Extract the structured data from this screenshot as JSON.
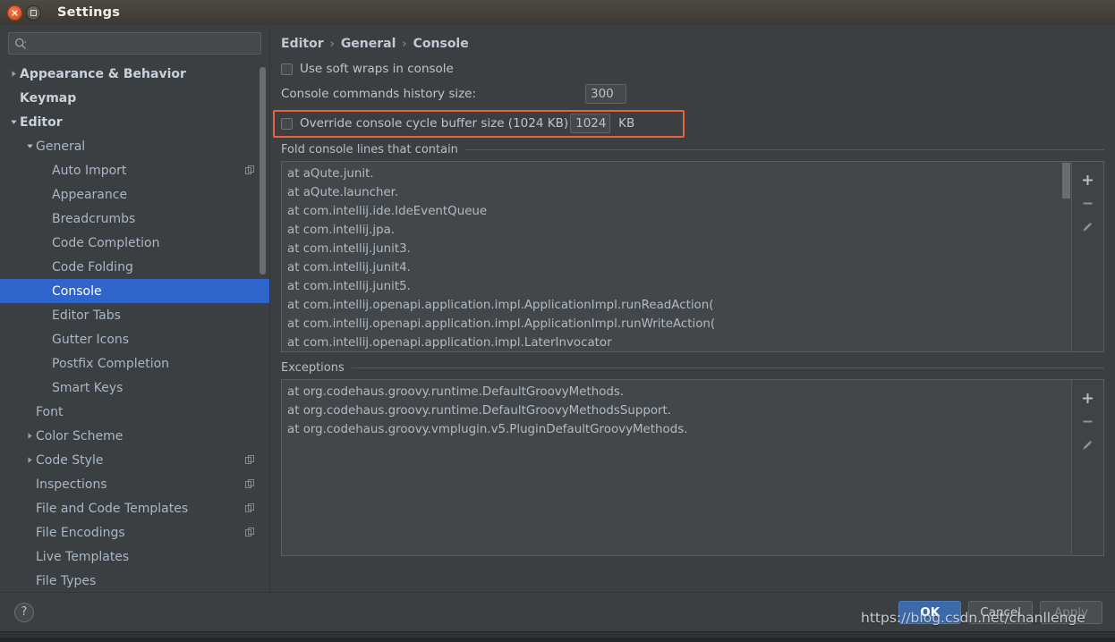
{
  "window": {
    "title": "Settings",
    "close_icon": "close-icon",
    "maximize_icon": "maximize-icon"
  },
  "sidebar": {
    "search": {
      "placeholder": "",
      "value": "",
      "icon": "search-icon"
    },
    "items": [
      {
        "label": "Appearance & Behavior",
        "indent": 0,
        "arrow": "right",
        "bold": true,
        "badge": false,
        "selected": false
      },
      {
        "label": "Keymap",
        "indent": 0,
        "arrow": "none",
        "bold": true,
        "badge": false,
        "selected": false
      },
      {
        "label": "Editor",
        "indent": 0,
        "arrow": "down",
        "bold": true,
        "badge": false,
        "selected": false
      },
      {
        "label": "General",
        "indent": 1,
        "arrow": "down",
        "bold": false,
        "badge": false,
        "selected": false
      },
      {
        "label": "Auto Import",
        "indent": 2,
        "arrow": "none",
        "bold": false,
        "badge": true,
        "selected": false
      },
      {
        "label": "Appearance",
        "indent": 2,
        "arrow": "none",
        "bold": false,
        "badge": false,
        "selected": false
      },
      {
        "label": "Breadcrumbs",
        "indent": 2,
        "arrow": "none",
        "bold": false,
        "badge": false,
        "selected": false
      },
      {
        "label": "Code Completion",
        "indent": 2,
        "arrow": "none",
        "bold": false,
        "badge": false,
        "selected": false
      },
      {
        "label": "Code Folding",
        "indent": 2,
        "arrow": "none",
        "bold": false,
        "badge": false,
        "selected": false
      },
      {
        "label": "Console",
        "indent": 2,
        "arrow": "none",
        "bold": false,
        "badge": false,
        "selected": true
      },
      {
        "label": "Editor Tabs",
        "indent": 2,
        "arrow": "none",
        "bold": false,
        "badge": false,
        "selected": false
      },
      {
        "label": "Gutter Icons",
        "indent": 2,
        "arrow": "none",
        "bold": false,
        "badge": false,
        "selected": false
      },
      {
        "label": "Postfix Completion",
        "indent": 2,
        "arrow": "none",
        "bold": false,
        "badge": false,
        "selected": false
      },
      {
        "label": "Smart Keys",
        "indent": 2,
        "arrow": "none",
        "bold": false,
        "badge": false,
        "selected": false
      },
      {
        "label": "Font",
        "indent": 1,
        "arrow": "none",
        "bold": false,
        "badge": false,
        "selected": false
      },
      {
        "label": "Color Scheme",
        "indent": 1,
        "arrow": "right",
        "bold": false,
        "badge": false,
        "selected": false
      },
      {
        "label": "Code Style",
        "indent": 1,
        "arrow": "right",
        "bold": false,
        "badge": true,
        "selected": false
      },
      {
        "label": "Inspections",
        "indent": 1,
        "arrow": "none",
        "bold": false,
        "badge": true,
        "selected": false
      },
      {
        "label": "File and Code Templates",
        "indent": 1,
        "arrow": "none",
        "bold": false,
        "badge": true,
        "selected": false
      },
      {
        "label": "File Encodings",
        "indent": 1,
        "arrow": "none",
        "bold": false,
        "badge": true,
        "selected": false
      },
      {
        "label": "Live Templates",
        "indent": 1,
        "arrow": "none",
        "bold": false,
        "badge": false,
        "selected": false
      },
      {
        "label": "File Types",
        "indent": 1,
        "arrow": "none",
        "bold": false,
        "badge": false,
        "selected": false
      }
    ]
  },
  "breadcrumb": {
    "part1": "Editor",
    "sep1": "›",
    "part2": "General",
    "sep2": "›",
    "part3": "Console"
  },
  "settings": {
    "soft_wraps_label": "Use soft wraps in console",
    "soft_wraps_checked": false,
    "history_label": "Console commands history size:",
    "history_value": "300",
    "override_label": "Override console cycle buffer size (1024 KB)",
    "override_checked": false,
    "override_value": "1024",
    "override_unit": "KB",
    "highlight_color": "#e8623a"
  },
  "fold_section": {
    "title": "Fold console lines that contain",
    "lines": [
      "at aQute.junit.",
      "at aQute.launcher.",
      "at com.intellij.ide.IdeEventQueue",
      "at com.intellij.jpa.",
      "at com.intellij.junit3.",
      "at com.intellij.junit4.",
      "at com.intellij.junit5.",
      "at com.intellij.openapi.application.impl.ApplicationImpl.runReadAction(",
      "at com.intellij.openapi.application.impl.ApplicationImpl.runWriteAction(",
      "at com.intellij.openapi.application.impl.LaterInvocator"
    ],
    "toolbar": {
      "add": "+",
      "remove": "−",
      "edit": "pencil-icon"
    }
  },
  "exceptions_section": {
    "title": "Exceptions",
    "lines": [
      "at org.codehaus.groovy.runtime.DefaultGroovyMethods.",
      "at org.codehaus.groovy.runtime.DefaultGroovyMethodsSupport.",
      "at org.codehaus.groovy.vmplugin.v5.PluginDefaultGroovyMethods."
    ],
    "toolbar": {
      "add": "+",
      "remove": "−",
      "edit": "pencil-icon"
    }
  },
  "footer": {
    "help_label": "?",
    "ok_label": "OK",
    "cancel_label": "Cancel",
    "apply_label": "Apply"
  },
  "watermark": {
    "text": "https://blog.csdn.net/chanllenge"
  }
}
